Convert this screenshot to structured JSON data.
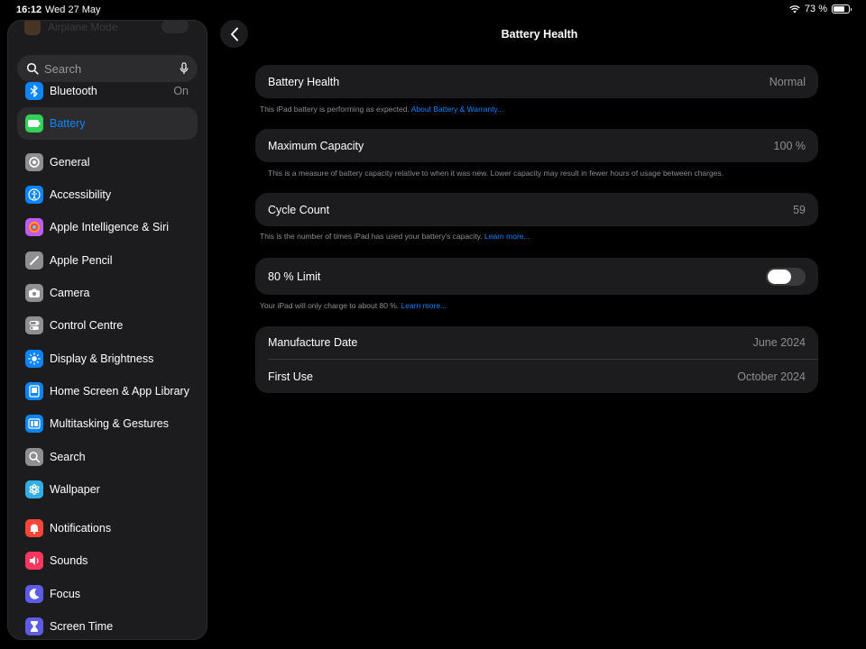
{
  "status_bar": {
    "time": "16:12",
    "date": "Wed 27 May",
    "battery": "73 %",
    "battery_level": 0.73
  },
  "sidebar": {
    "ghost_item": "Airplane Mode",
    "search_placeholder": "Search",
    "items": [
      {
        "label": "Bluetooth",
        "value": "On",
        "icon": "bluetooth-icon",
        "color": "#0a84ff"
      },
      {
        "label": "Battery",
        "icon": "battery-icon",
        "color": "#30d158",
        "selected": true
      },
      {
        "label": "General",
        "icon": "gear-icon",
        "color": "#8e8e93"
      },
      {
        "label": "Accessibility",
        "icon": "accessibility-icon",
        "color": "#0a84ff"
      },
      {
        "label": "Apple Intelligence & Siri",
        "icon": "siri-icon",
        "color": "#bf5af2"
      },
      {
        "label": "Apple Pencil",
        "icon": "pencil-icon",
        "color": "#8e8e93"
      },
      {
        "label": "Camera",
        "icon": "camera-icon",
        "color": "#8e8e93"
      },
      {
        "label": "Control Centre",
        "icon": "control-centre-icon",
        "color": "#8e8e93"
      },
      {
        "label": "Display & Brightness",
        "icon": "sun-icon",
        "color": "#0a84ff"
      },
      {
        "label": "Home Screen & App Library",
        "icon": "home-screen-icon",
        "color": "#0a84ff"
      },
      {
        "label": "Multitasking & Gestures",
        "icon": "multitasking-icon",
        "color": "#0a84ff"
      },
      {
        "label": "Search",
        "icon": "search-icon",
        "color": "#8e8e93"
      },
      {
        "label": "Wallpaper",
        "icon": "wallpaper-icon",
        "color": "#32ade6"
      },
      {
        "label": "Notifications",
        "icon": "bell-icon",
        "color": "#ff453a"
      },
      {
        "label": "Sounds",
        "icon": "speaker-icon",
        "color": "#ff375f"
      },
      {
        "label": "Focus",
        "icon": "moon-icon",
        "color": "#5e5ce6"
      },
      {
        "label": "Screen Time",
        "icon": "hourglass-icon",
        "color": "#5e5ce6"
      }
    ]
  },
  "main": {
    "title": "Battery Health",
    "battery_health": {
      "label": "Battery Health",
      "value": "Normal",
      "footnote": "This iPad battery is performing as expected.",
      "link": "About Battery & Warranty..."
    },
    "max_capacity": {
      "label": "Maximum Capacity",
      "value": "100 %",
      "footnote": "This is a measure of battery capacity relative to when it was new. Lower capacity may result in fewer hours of usage between charges."
    },
    "cycle_count": {
      "label": "Cycle Count",
      "value": "59",
      "footnote": "This is the number of times iPad has used your battery's capacity.",
      "link": "Learn more..."
    },
    "limit": {
      "label": "80 % Limit",
      "enabled": false,
      "footnote": "Your iPad will only charge to about 80 %.",
      "link": "Learn more..."
    },
    "dates": {
      "manufacture_label": "Manufacture Date",
      "manufacture_value": "June 2024",
      "first_use_label": "First Use",
      "first_use_value": "October 2024"
    }
  }
}
